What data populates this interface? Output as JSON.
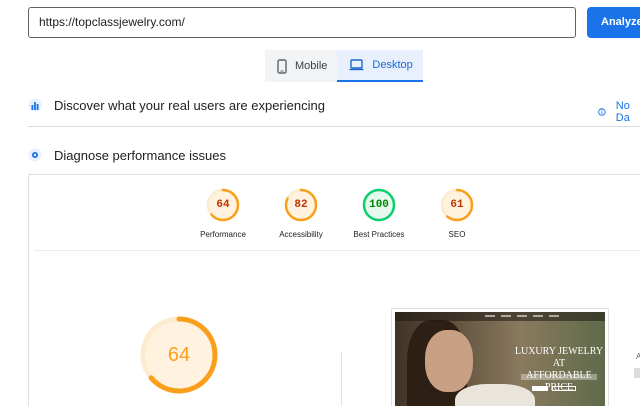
{
  "url_input": {
    "value": "https://topclassjewelry.com/"
  },
  "analyze_button": {
    "label": "Analyze"
  },
  "device_tabs": [
    {
      "label": "Mobile",
      "icon": "smartphone-icon",
      "active": false
    },
    {
      "label": "Desktop",
      "icon": "laptop-icon",
      "active": true
    }
  ],
  "sections": {
    "real_users": {
      "title": "Discover what your real users are experiencing",
      "icon": "crux-icon",
      "side_link": "No Da"
    },
    "diagnose": {
      "title": "Diagnose performance issues",
      "icon": "lighthouse-icon"
    }
  },
  "scores": [
    {
      "label": "Performance",
      "value": "64",
      "color": "#fa9f1b"
    },
    {
      "label": "Accessibility",
      "value": "82",
      "color": "#fa9f1b"
    },
    {
      "label": "Best Practices",
      "value": "100",
      "color": "#0cce6b"
    },
    {
      "label": "SEO",
      "value": "61",
      "color": "#fa9f1b"
    }
  ],
  "main_score": {
    "value": "64",
    "color": "#fa9f1b"
  },
  "screenshot": {
    "hero_title_line1": "LUXURY JEWELRY AT",
    "hero_title_line2": "AFFORDABLE PRICE"
  },
  "edge_text": "A"
}
